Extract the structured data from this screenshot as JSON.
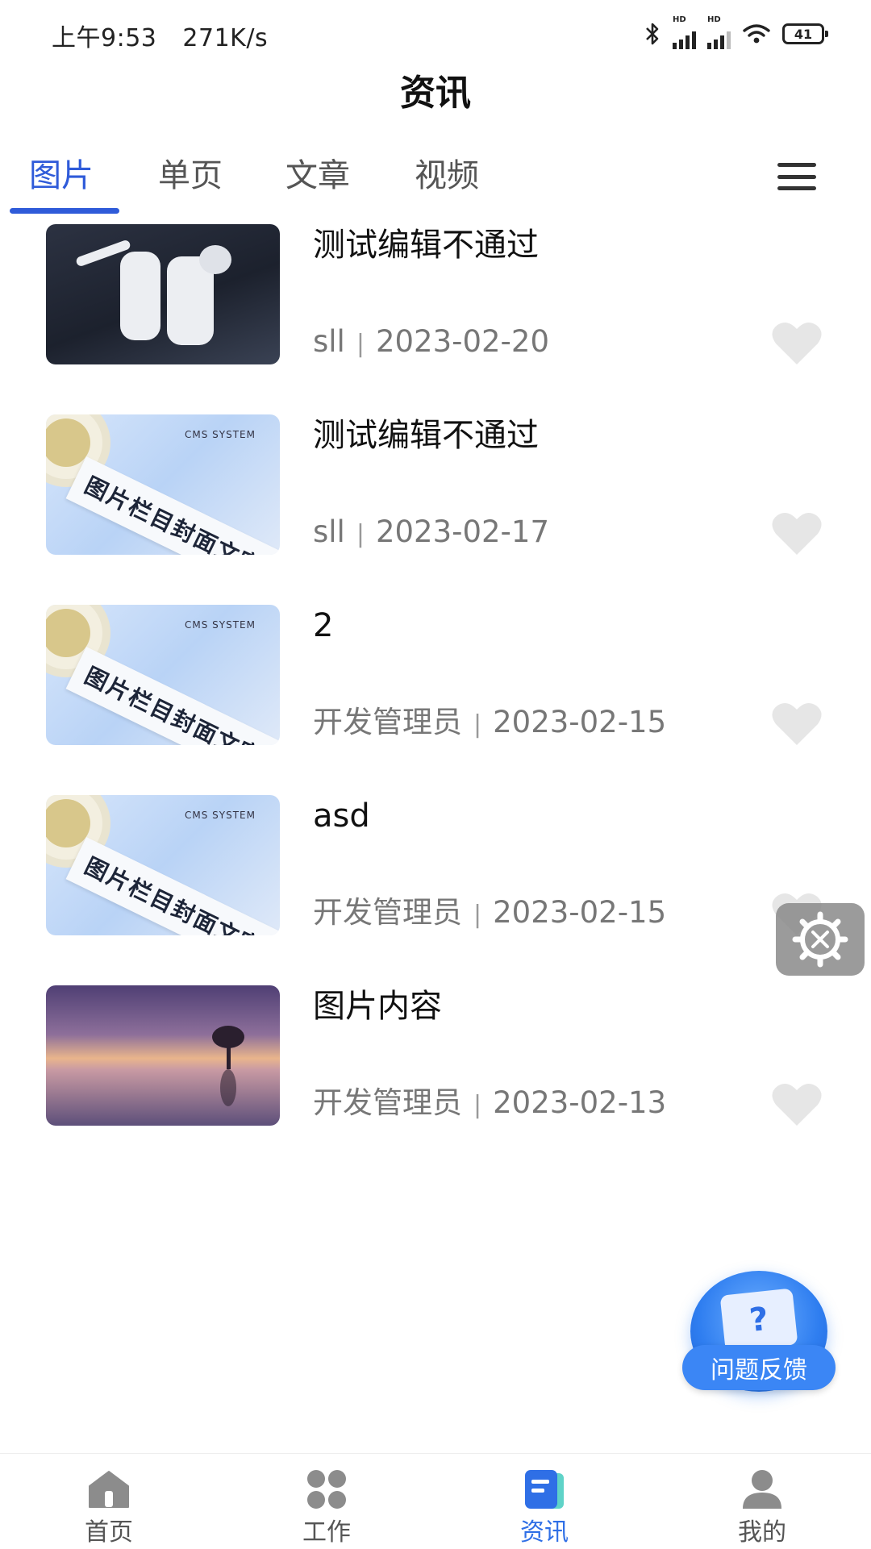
{
  "status_bar": {
    "time": "上午9:53",
    "speed": "271K/s",
    "battery": "41",
    "signal_label": "HD"
  },
  "header": {
    "title": "资讯"
  },
  "tabs": [
    {
      "label": "图片",
      "active": true
    },
    {
      "label": "单页",
      "active": false
    },
    {
      "label": "文章",
      "active": false
    },
    {
      "label": "视频",
      "active": false
    }
  ],
  "articles": [
    {
      "title": "测试编辑不通过",
      "author": "sll",
      "date": "2023-02-20",
      "image": "astronauts"
    },
    {
      "title": "测试编辑不通过",
      "author": "sll",
      "date": "2023-02-17",
      "image": "cms-cover"
    },
    {
      "title": "2",
      "author": "开发管理员",
      "date": "2023-02-15",
      "image": "cms-cover"
    },
    {
      "title": "asd",
      "author": "开发管理员",
      "date": "2023-02-15",
      "image": "cms-cover"
    },
    {
      "title": "图片内容",
      "author": "开发管理员",
      "date": "2023-02-13",
      "image": "sunset-tree"
    }
  ],
  "thumb_text": {
    "cms_label": "CMS SYSTEM",
    "cms_tape": "图片栏目封面文字"
  },
  "separator": "|",
  "feedback": {
    "label": "问题反馈",
    "icon_glyph": "?"
  },
  "bottom_nav": [
    {
      "label": "首页",
      "icon": "home-icon",
      "active": false
    },
    {
      "label": "工作",
      "icon": "grid-icon",
      "active": false
    },
    {
      "label": "资讯",
      "icon": "news-icon",
      "active": true
    },
    {
      "label": "我的",
      "icon": "user-icon",
      "active": false
    }
  ],
  "colors": {
    "accent": "#2f5bd9",
    "nav_active": "#2f6fe6",
    "meta": "#777777",
    "heart": "#e6e6e6"
  }
}
